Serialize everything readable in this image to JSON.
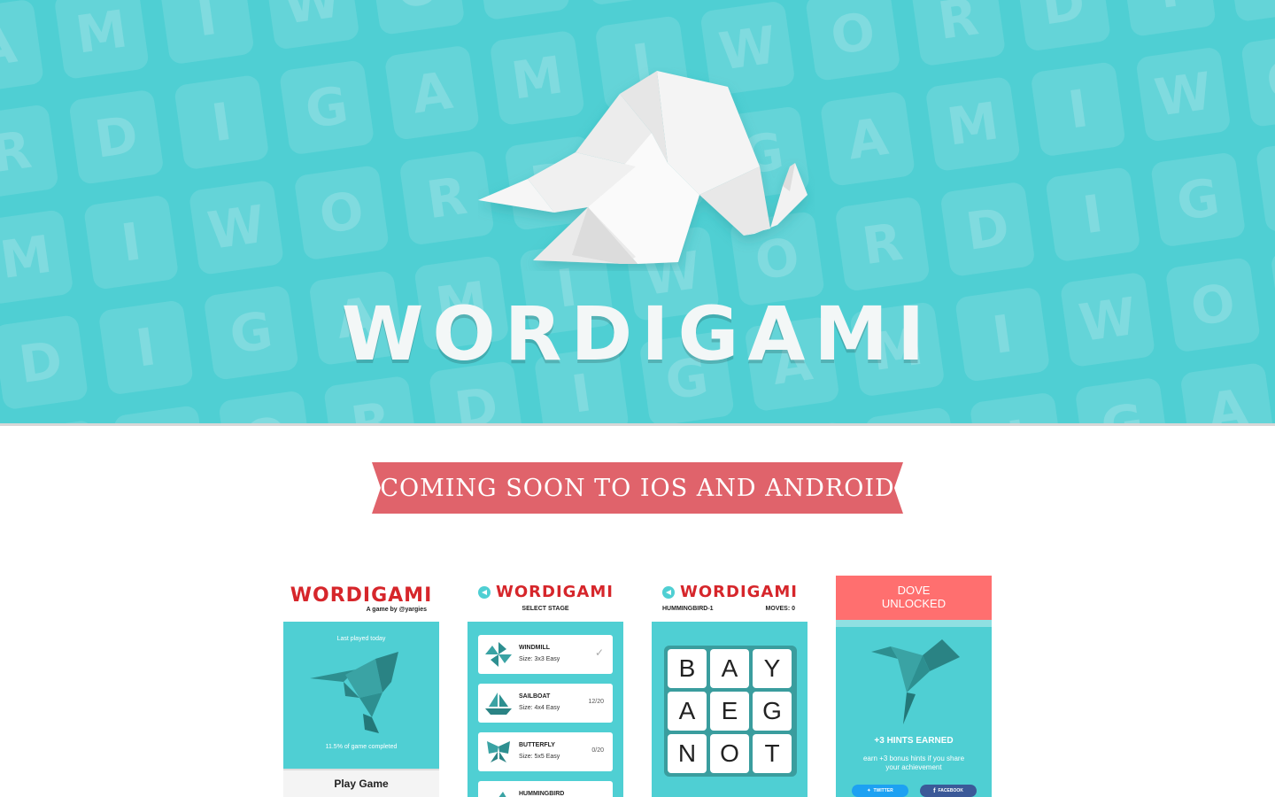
{
  "hero": {
    "title": "WORDIGAMI",
    "background_tiles": [
      "W",
      "O",
      "R",
      "D",
      "I",
      "G",
      "A",
      "M",
      "I",
      "W",
      "O",
      "R",
      "D",
      "I",
      "G",
      "A",
      "M",
      "I"
    ],
    "colors": {
      "background": "#4fcfd3",
      "title": "#f3f7f7"
    },
    "logo_icon": "origami-elephant-icon"
  },
  "banner": {
    "text": "COMING SOON TO IOS AND ANDROID",
    "color": "#e0636b"
  },
  "screens": {
    "home": {
      "logo": "WORDIGAMI",
      "byline": "A game by @yargies",
      "last_played": "Last played today",
      "progress": "11.5% of game completed",
      "play_button": "Play Game",
      "icon": "hummingbird-icon"
    },
    "select": {
      "logo": "WORDIGAMI",
      "subtitle": "SELECT STAGE",
      "stages": [
        {
          "name": "WINDMILL",
          "size": "Size: 3x3 Easy",
          "progress": "✓",
          "icon": "windmill-icon"
        },
        {
          "name": "SAILBOAT",
          "size": "Size: 4x4 Easy",
          "progress": "12/20",
          "icon": "sailboat-icon"
        },
        {
          "name": "BUTTERFLY",
          "size": "Size: 5x5 Easy",
          "progress": "0/20",
          "icon": "butterfly-icon"
        },
        {
          "name": "HUMMINGBIRD",
          "size": "",
          "progress": "",
          "icon": "hummingbird-icon"
        }
      ]
    },
    "game": {
      "logo": "WORDIGAMI",
      "level": "HUMMINGBIRD-1",
      "moves": "MOVES: 0",
      "letters": [
        "B",
        "A",
        "Y",
        "A",
        "E",
        "G",
        "N",
        "O",
        "T"
      ]
    },
    "unlock": {
      "title_line1": "DOVE",
      "title_line2": "UNLOCKED",
      "hints": "+3 HINTS EARNED",
      "description": "earn +3 bonus hints if you share your achievement",
      "twitter": "TWITTER",
      "facebook": "FACEBOOK",
      "icon": "dove-icon"
    }
  }
}
